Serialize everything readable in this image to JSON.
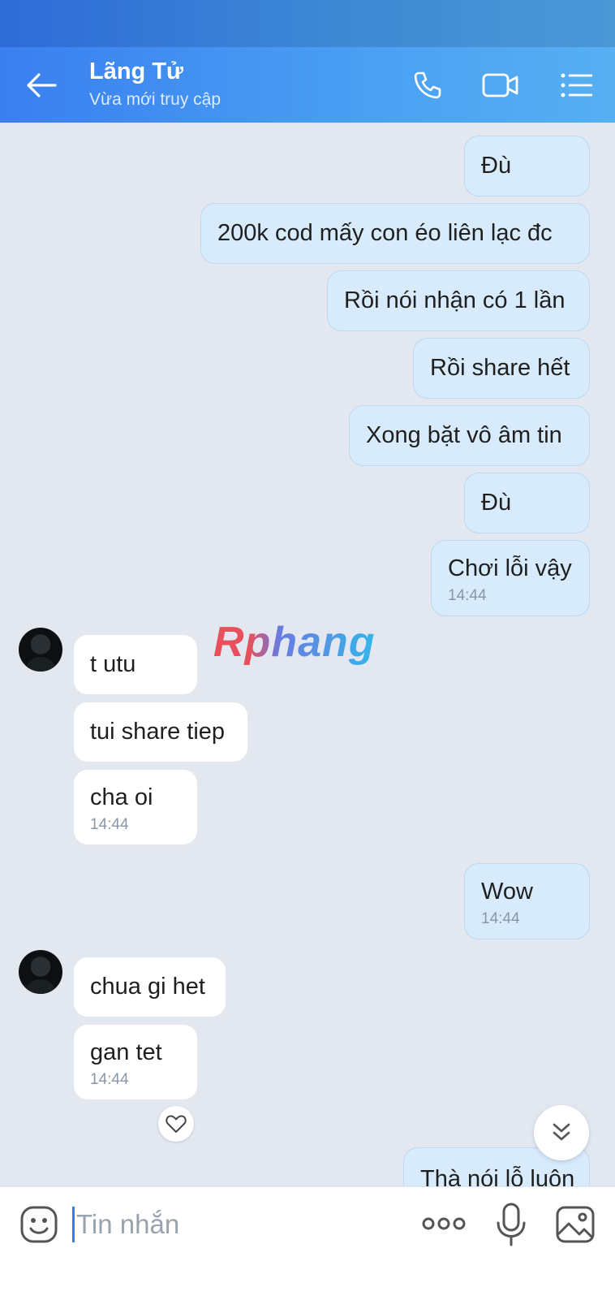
{
  "header": {
    "title": "Lãng Tử",
    "subtitle": "Vừa mới truy cập",
    "icons": [
      "back-arrow-icon",
      "phone-icon",
      "video-call-icon",
      "menu-list-icon"
    ]
  },
  "messages": [
    {
      "dir": "out",
      "text": "Đù"
    },
    {
      "dir": "out",
      "text": "200k cod mấy con éo liên lạc đc"
    },
    {
      "dir": "out",
      "text": "Rồi nói nhận có 1 lần"
    },
    {
      "dir": "out",
      "text": "Rồi share hết"
    },
    {
      "dir": "out",
      "text": "Xong bặt vô âm tin"
    },
    {
      "dir": "out",
      "text": "Đù"
    },
    {
      "dir": "out",
      "text": "Chơi lỗi vậy",
      "time": "14:44"
    },
    {
      "dir": "in",
      "text": "t utu"
    },
    {
      "dir": "in",
      "text": "tui share tiep"
    },
    {
      "dir": "in",
      "text": "cha oi",
      "time": "14:44"
    },
    {
      "dir": "out",
      "text": "Wow",
      "time": "14:44"
    },
    {
      "dir": "in",
      "text": "chua gi het"
    },
    {
      "dir": "in",
      "text": "gan tet",
      "time": "14:44"
    },
    {
      "dir": "out",
      "text": "Thà nói lỗ luôn"
    }
  ],
  "watermark": "Rphang",
  "composer": {
    "placeholder": "Tin nhắn"
  },
  "colors": {
    "header_start": "#3a7ff0",
    "header_end": "#56b0f2",
    "outgoing_bubble": "#d7ebfd",
    "incoming_bubble": "#ffffff",
    "chat_background": "#e3e8f0"
  }
}
